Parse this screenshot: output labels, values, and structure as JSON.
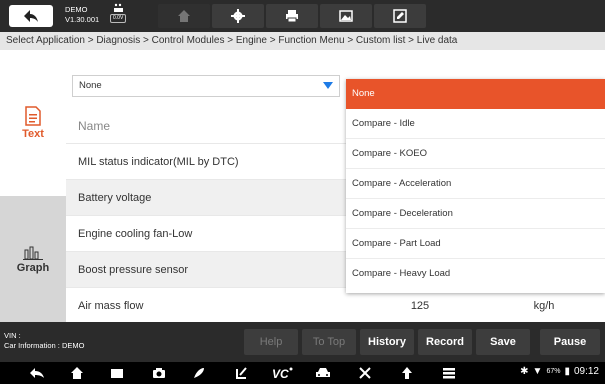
{
  "toolbar": {
    "demo_label": "DEMO",
    "version": "V1.30.001",
    "voltage": "0.0V",
    "buttons": [
      "home-icon",
      "gear-icon",
      "print-icon",
      "image-icon",
      "edit-icon"
    ]
  },
  "breadcrumb": "Select Application > Diagnosis > Control Modules > Engine > Function Menu > Custom list > Live data",
  "sidebar": {
    "tabs": [
      {
        "label": "Text",
        "icon": "document-icon",
        "active": true
      },
      {
        "label": "Graph",
        "icon": "bar-graph-icon",
        "active": false
      }
    ]
  },
  "list": {
    "select_value": "None",
    "header_name": "Name",
    "rows": [
      {
        "name": "MIL status indicator(MIL by DTC)",
        "value": "",
        "unit": ""
      },
      {
        "name": "Battery voltage",
        "value": "",
        "unit": ""
      },
      {
        "name": "Engine cooling fan-Low",
        "value": "",
        "unit": ""
      },
      {
        "name": "Boost pressure sensor",
        "value": "",
        "unit": ""
      },
      {
        "name": "Air mass flow",
        "value": "125",
        "unit": "kg/h"
      }
    ]
  },
  "dropdown": {
    "options": [
      "None",
      "Compare - Idle",
      "Compare - KOEO",
      "Compare - Acceleration",
      "Compare - Deceleration",
      "Compare - Part Load",
      "Compare - Heavy Load"
    ],
    "selected_index": 0
  },
  "footer": {
    "vin_label": "VIN :",
    "car_info": "Car Information : DEMO",
    "actions": [
      "Help",
      "To Top",
      "History",
      "Record",
      "Save",
      "Pause"
    ],
    "disabled_actions": [
      "Help",
      "To Top"
    ]
  },
  "system": {
    "battery": "67%",
    "time": "09:12"
  },
  "colors": {
    "accent": "#e8542a",
    "toolbar_bg": "#2b2b2b",
    "dropdown_arrow": "#1e7be6"
  }
}
